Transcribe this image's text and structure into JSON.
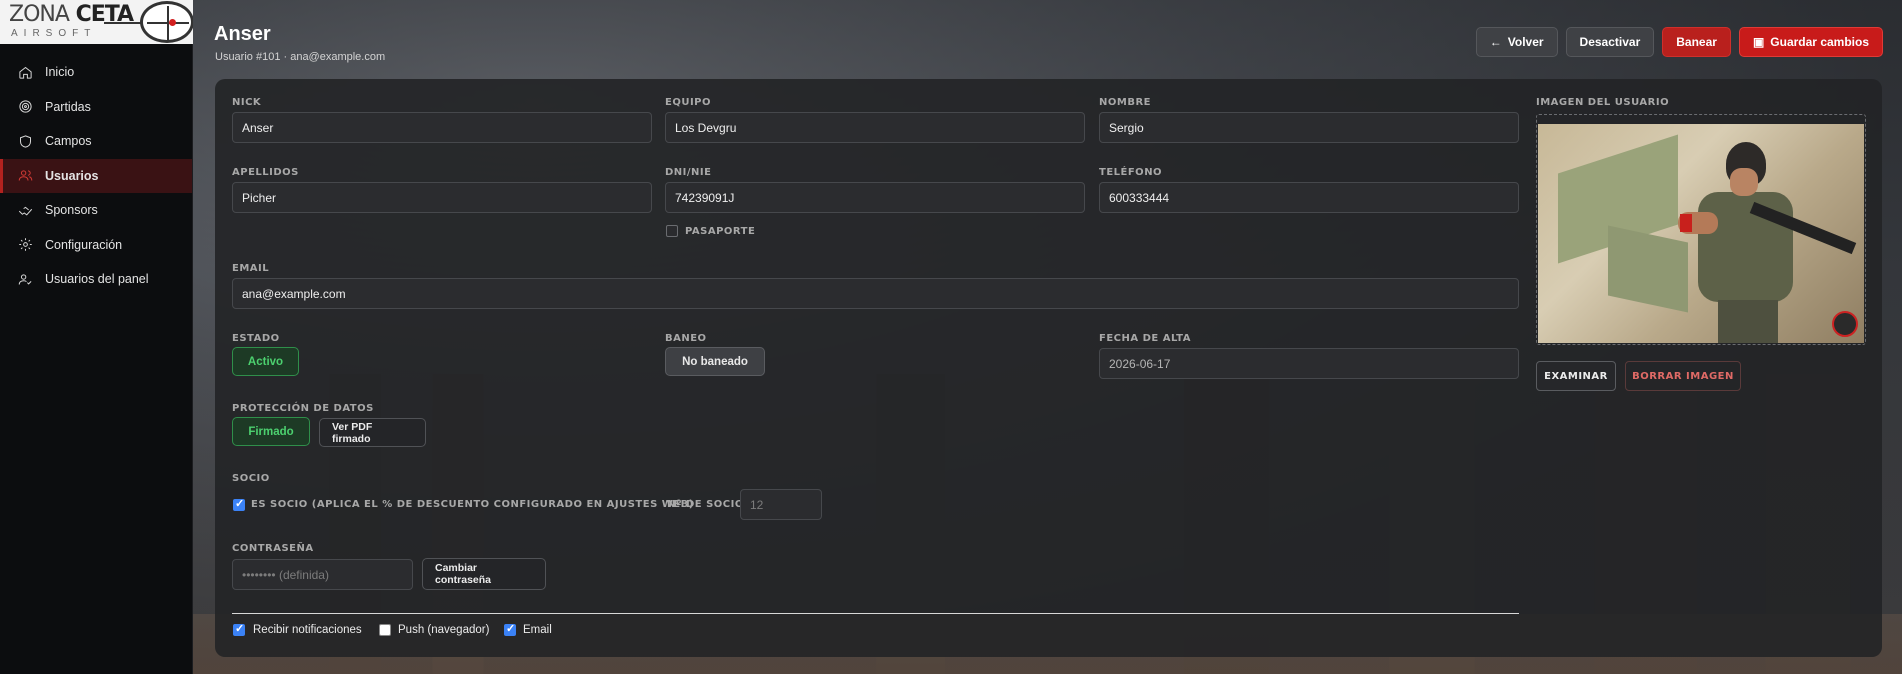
{
  "logo": {
    "line1_bold": "ZONA",
    "line1_rest": "CETA",
    "line2": "AIRSOFT"
  },
  "sidebar": {
    "items": [
      {
        "label": "Inicio",
        "icon": "home-icon"
      },
      {
        "label": "Partidas",
        "icon": "target-icon"
      },
      {
        "label": "Campos",
        "icon": "shield-icon"
      },
      {
        "label": "Usuarios",
        "icon": "users-icon",
        "active": true
      },
      {
        "label": "Sponsors",
        "icon": "handshake-icon"
      },
      {
        "label": "Configuración",
        "icon": "gear-icon"
      },
      {
        "label": "Usuarios del panel",
        "icon": "user-check-icon"
      }
    ]
  },
  "header": {
    "title": "Anser",
    "subtitle": "Usuario #101 · ana@example.com",
    "buttons": {
      "back": "Volver",
      "deactivate": "Desactivar",
      "ban": "Banear",
      "save": "Guardar cambios"
    }
  },
  "form": {
    "nick": {
      "label": "NICK",
      "value": "Anser"
    },
    "team": {
      "label": "EQUIPO",
      "value": "Los Devgru"
    },
    "name": {
      "label": "NOMBRE",
      "value": "Sergio"
    },
    "surname": {
      "label": "APELLIDOS",
      "value": "Picher"
    },
    "dni": {
      "label": "DNI/NIE",
      "value": "74239091J"
    },
    "phone": {
      "label": "TELÉFONO",
      "value": "600333444"
    },
    "passport": {
      "label": "PASAPORTE",
      "checked": false
    },
    "email": {
      "label": "EMAIL",
      "value": "ana@example.com"
    },
    "status": {
      "label": "ESTADO",
      "value": "Activo"
    },
    "ban": {
      "label": "BANEO",
      "value": "No baneado"
    },
    "signup": {
      "label": "FECHA DE ALTA",
      "value": "2026-06-17"
    },
    "privacy": {
      "label": "PROTECCIÓN DE DATOS",
      "status": "Firmado",
      "pdf_button": "Ver PDF firmado"
    },
    "member": {
      "label": "SOCIO",
      "checkbox_label": "ES SOCIO (APLICA EL % DE DESCUENTO CONFIGURADO EN AJUSTES WEB)",
      "checked": true,
      "number_label": "Nº DE SOCIO",
      "number_placeholder": "12"
    },
    "password": {
      "label": "CONTRASEÑA",
      "placeholder": "•••••••• (definida)",
      "change_button": "Cambiar contraseña"
    },
    "notifications": {
      "receive": {
        "label": "Recibir notificaciones",
        "checked": true
      },
      "push": {
        "label": "Push (navegador)",
        "checked": false
      },
      "email": {
        "label": "Email",
        "checked": true
      }
    }
  },
  "image": {
    "label": "IMAGEN DEL USUARIO",
    "browse": "EXAMINAR",
    "delete": "BORRAR IMAGEN"
  },
  "colors": {
    "accent_red": "#c81b1a",
    "success_green": "#4cd06f",
    "checkbox_blue": "#3b82f6"
  }
}
